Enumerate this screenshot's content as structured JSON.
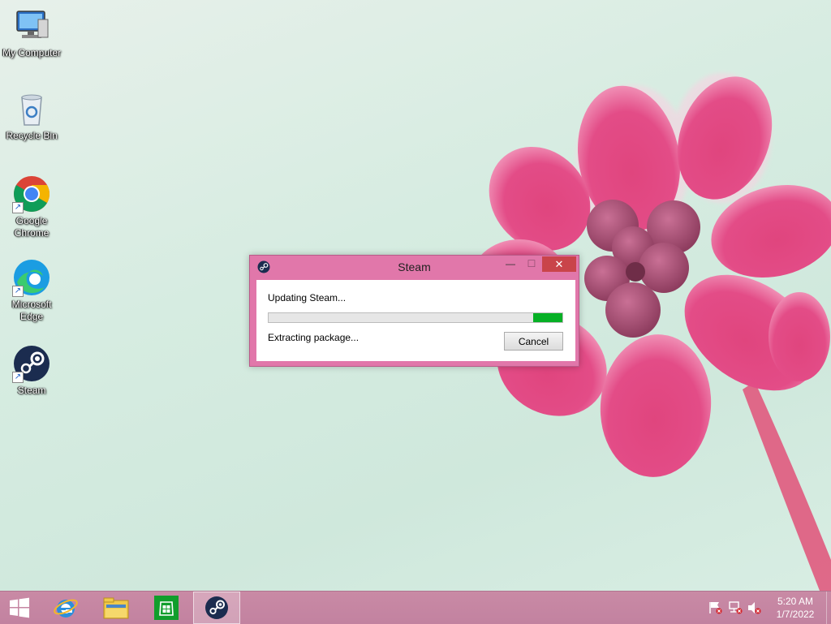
{
  "desktop": {
    "icons": [
      {
        "label": "My Computer",
        "icon": "computer-icon"
      },
      {
        "label": "Recycle Bin",
        "icon": "recycle-bin-icon"
      },
      {
        "label": "Google Chrome",
        "icon": "chrome-icon"
      },
      {
        "label": "Microsoft Edge",
        "icon": "edge-icon"
      },
      {
        "label": "Steam",
        "icon": "steam-icon"
      }
    ]
  },
  "steam_dialog": {
    "title": "Steam",
    "status": "Updating Steam...",
    "detail": "Extracting package...",
    "cancel_label": "Cancel",
    "progress_fraction": 0.1,
    "minimize_glyph": "—",
    "maximize_glyph": "☐",
    "close_glyph": "✕"
  },
  "taskbar": {
    "buttons": [
      "start-icon",
      "internet-explorer-icon",
      "file-explorer-icon",
      "store-icon",
      "steam-icon"
    ],
    "tray": [
      "action-center-flag-icon",
      "network-icon",
      "volume-muted-icon"
    ],
    "clock": {
      "time": "5:20 AM",
      "date": "1/7/2022"
    }
  },
  "colors": {
    "window_frame": "#e177aa",
    "close_button": "#c9444a",
    "progress_fill": "#06b025",
    "taskbar": "#c586a2"
  }
}
